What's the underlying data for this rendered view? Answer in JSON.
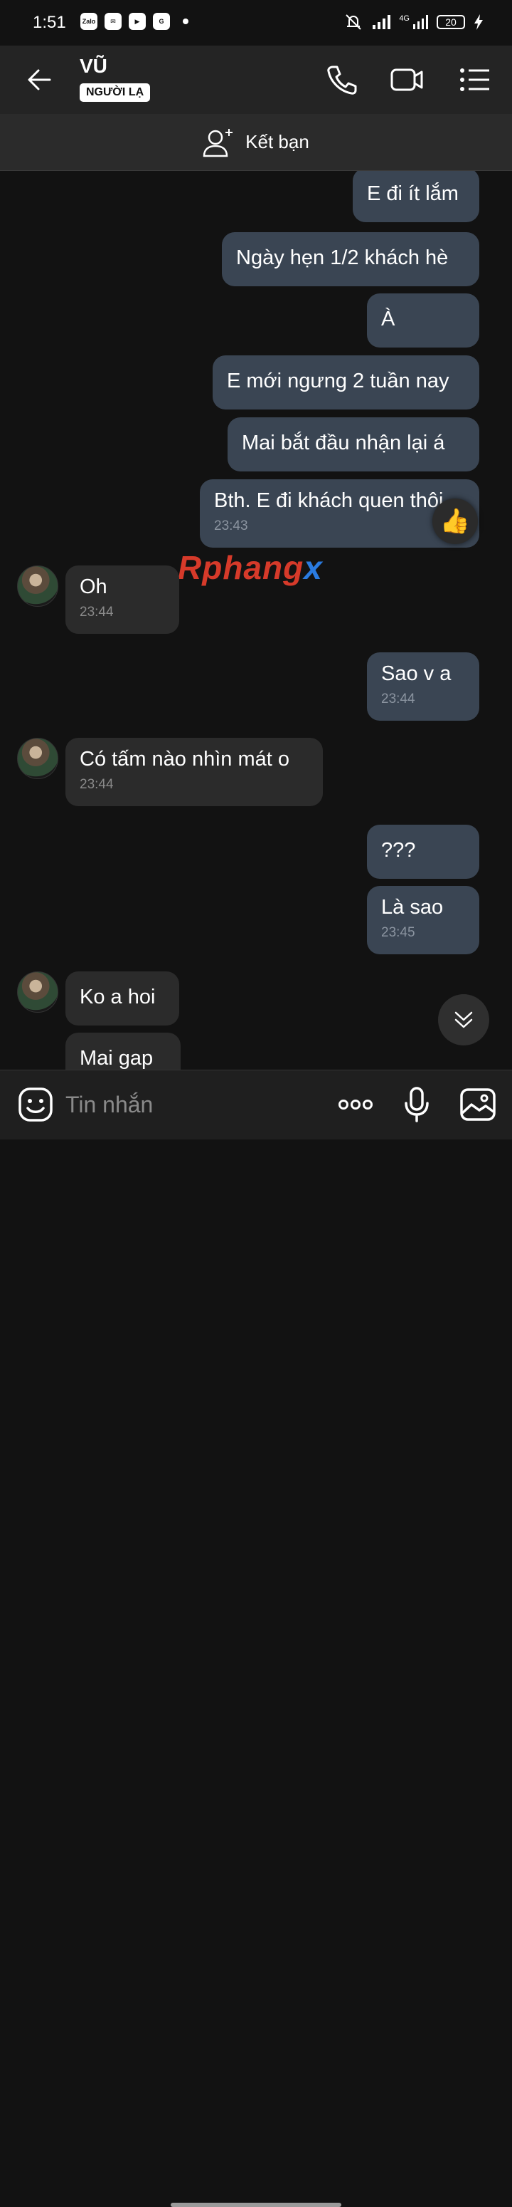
{
  "status": {
    "time": "1:51",
    "network": "4G",
    "battery": "20"
  },
  "header": {
    "name": "VŨ",
    "badge": "NGƯỜI LẠ"
  },
  "friend_bar": {
    "label": "Kết bạn"
  },
  "messages": [
    {
      "from": "me",
      "text": "E đi ít lắm",
      "time": ""
    },
    {
      "from": "me",
      "text": "Ngày hẹn 1/2 khách hè",
      "time": ""
    },
    {
      "from": "me",
      "text": "À",
      "time": ""
    },
    {
      "from": "me",
      "text": "E mới ngưng 2 tuần nay",
      "time": ""
    },
    {
      "from": "me",
      "text": "Mai bắt đầu nhận lại á",
      "time": ""
    },
    {
      "from": "me",
      "text": "Bth. E đi khách quen thôi",
      "time": "23:43"
    },
    {
      "from": "them",
      "text": "Oh",
      "time": "23:44"
    },
    {
      "from": "me",
      "text": "Sao v a",
      "time": "23:44"
    },
    {
      "from": "them",
      "text": "Có tấm nào nhìn mát o",
      "time": "23:44"
    },
    {
      "from": "me",
      "text": "???",
      "time": ""
    },
    {
      "from": "me",
      "text": "Là sao",
      "time": "23:45"
    },
    {
      "from": "them",
      "text": "Ko a hoi",
      "time": ""
    },
    {
      "from": "them",
      "text": "Mai gap",
      "time": ""
    }
  ],
  "watermark": {
    "part1": "Rphang",
    "part2": "x"
  },
  "input": {
    "placeholder": "Tin nhắn"
  },
  "icons": {
    "back": "arrow-left-icon",
    "call": "phone-icon",
    "video": "video-camera-icon",
    "menu": "menu-list-icon",
    "add_friend": "add-user-icon",
    "emoji": "emoji-sticker-icon",
    "more": "more-dots-icon",
    "mic": "microphone-icon",
    "gallery": "image-gallery-icon",
    "like": "thumbs-up-icon",
    "scroll_down": "double-chevron-down-icon"
  }
}
